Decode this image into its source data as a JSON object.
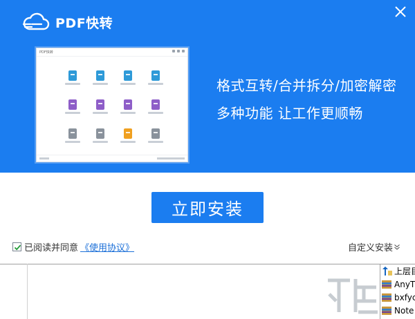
{
  "window": {
    "title": "PDF快转",
    "close_icon": "close-icon"
  },
  "banner": {
    "tagline_1": "格式互转/合并拆分/加密解密",
    "tagline_2": "多种功能 让工作更顺畅"
  },
  "actions": {
    "install_label": "立即安装",
    "agree_text": "已阅读并同意",
    "agree_link": "《使用协议》",
    "agree_checked": true,
    "custom_install_label": "自定义安装",
    "custom_install_icon": "double-chevron-down-icon"
  },
  "file_list": {
    "items": [
      {
        "label": "上层目",
        "icon": "up-folder-icon"
      },
      {
        "label": "AnyT",
        "icon": "archive-icon"
      },
      {
        "label": "bxfyc",
        "icon": "archive-icon"
      },
      {
        "label": "Note",
        "icon": "archive-icon"
      }
    ]
  },
  "colors": {
    "brand_blue": "#1b7df0",
    "link_blue": "#1b6fd8",
    "text": "#333333"
  }
}
